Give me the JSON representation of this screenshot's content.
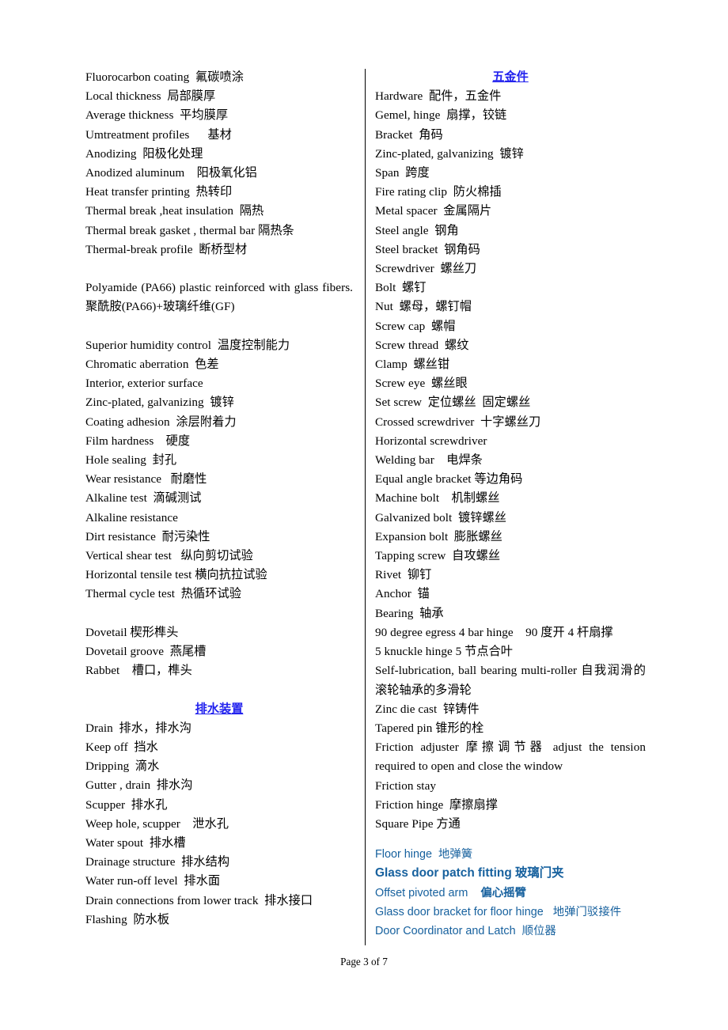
{
  "document": {
    "footer": "Page 3 of 7",
    "heading_color": "#2222ee",
    "blue_text_color": "#17619e"
  },
  "left_column": {
    "entries": [
      "Fluorocarbon coating  氟碳喷涂",
      "Local thickness  局部膜厚",
      "Average thickness  平均膜厚",
      "Umtreatment profiles      基材",
      "Anodizing  阳极化处理",
      "Anodized aluminum    阳极氧化铝",
      "Heat transfer printing  热转印",
      "Thermal break ,heat insulation  隔热",
      "Thermal break gasket , thermal bar 隔热条",
      "Thermal-break profile  断桥型材"
    ],
    "paragraph": "Polyamide (PA66) plastic reinforced with glass fibers.  聚酰胺(PA66)+玻璃纤维(GF)",
    "entries2": [
      "Superior humidity control  温度控制能力",
      "Chromatic aberration  色差",
      "Interior, exterior surface",
      "Zinc-plated, galvanizing  镀锌",
      "Coating adhesion  涂层附着力",
      "Film hardness    硬度",
      "Hole sealing  封孔",
      "Wear resistance   耐磨性",
      "Alkaline test  滴碱测试",
      "Alkaline resistance",
      "Dirt resistance  耐污染性",
      "Vertical shear test   纵向剪切试验",
      "Horizontal tensile test 横向抗拉试验",
      "Thermal cycle test  热循环试验"
    ],
    "entries3": [
      "Dovetail 楔形榫头",
      "Dovetail groove  燕尾槽",
      "Rabbet    槽口，榫头"
    ],
    "section_heading": "排水装置",
    "entries4": [
      "Drain  排水，排水沟",
      "Keep off  挡水",
      "Dripping  滴水",
      "Gutter , drain  排水沟",
      "Scupper  排水孔",
      "Weep hole, scupper    泄水孔",
      "Water spout  排水槽",
      "Drainage structure  排水结构",
      "Water run-off level  排水面",
      "Drain connections from lower track  排水接口",
      "Flashing  防水板"
    ]
  },
  "right_column": {
    "section_heading": "五金件",
    "entries": [
      "Hardware  配件，五金件",
      "Gemel, hinge  扇撑，铰链",
      "Bracket  角码",
      "Zinc-plated, galvanizing  镀锌",
      "Span  跨度",
      "Fire rating clip  防火棉插",
      "Metal spacer  金属隔片",
      "Steel angle  钢角",
      "Steel bracket  钢角码",
      "Screwdriver  螺丝刀",
      "Bolt  螺钉",
      "Nut  螺母，螺钉帽",
      "Screw cap  螺帽",
      "Screw thread  螺纹",
      "Clamp  螺丝钳",
      "Screw eye  螺丝眼",
      "Set screw  定位螺丝  固定螺丝",
      "Crossed screwdriver  十字螺丝刀",
      "Horizontal screwdriver",
      "Welding bar    电焊条",
      "Equal angle bracket 等边角码",
      "Machine bolt    机制螺丝",
      "Galvanized bolt  镀锌螺丝",
      "Expansion bolt  膨胀螺丝",
      "Tapping screw  自攻螺丝",
      "Rivet  铆钉",
      "Anchor  锚",
      "Bearing  轴承",
      "90 degree egress 4 bar hinge    90 度开 4 杆扇撑",
      "5 knuckle hinge 5 节点合叶"
    ],
    "paragraph1": "Self-lubrication, ball bearing multi-roller  自我润滑的滚轮轴承的多滑轮",
    "entries2": [
      "Zinc die cast  锌铸件",
      "Tapered pin 锥形的栓"
    ],
    "paragraph2": "Friction adjuster  摩擦调节器   adjust the tension required to open and close the window",
    "entries3": [
      "Friction stay",
      "Friction hinge  摩擦扇撑",
      "Square Pipe 方通"
    ],
    "blue_entries": [
      {
        "text": "Floor hinge  地弹簧",
        "bold": false
      },
      {
        "text": "Glass door patch fitting 玻璃门夹",
        "bold": true
      },
      {
        "en": "Offset pivoted arm    ",
        "cn": "偏心摇臂",
        "cn_bold": true,
        "bold": false
      },
      {
        "text": "Glass door bracket for floor hinge   地弹门驳接件",
        "bold": false
      },
      {
        "text": "Door Coordinator and Latch  顺位器",
        "bold": false
      }
    ]
  }
}
